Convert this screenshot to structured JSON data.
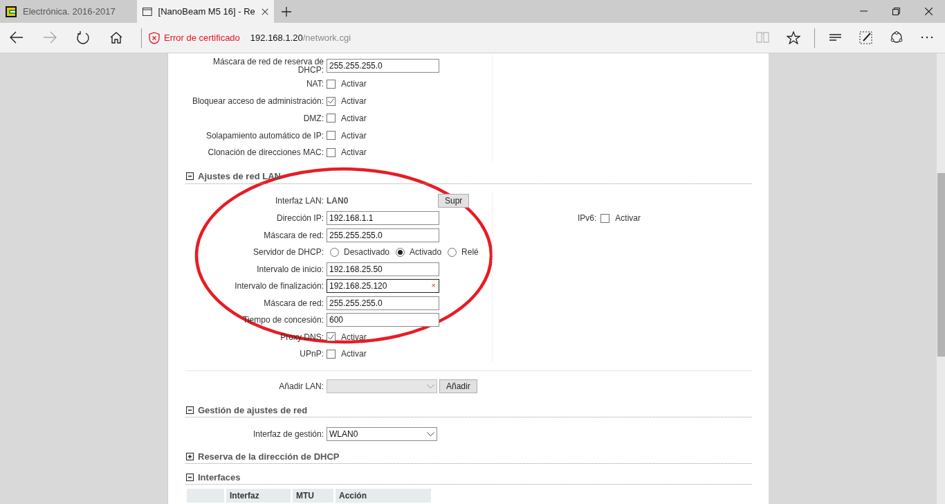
{
  "browser": {
    "tabs": [
      {
        "title": "Electrónica. 2016-2017",
        "selected": false
      },
      {
        "title": "[NanoBeam M5 16] - Re",
        "selected": true
      }
    ],
    "nav_buttons": [
      {
        "kind": "back",
        "disabled": false
      },
      {
        "kind": "forward",
        "disabled": true
      },
      {
        "kind": "refresh",
        "disabled": false
      },
      {
        "kind": "home",
        "disabled": false
      }
    ],
    "address": {
      "warning": "Error de certificado",
      "host": "192.168.1.20",
      "path": "/network.cgi"
    },
    "tools": [
      {
        "kind": "reading",
        "disabled": true
      },
      {
        "kind": "favorite",
        "disabled": false
      },
      {
        "kind": "hub",
        "disabled": false
      },
      {
        "kind": "note",
        "disabled": false
      },
      {
        "kind": "share",
        "disabled": false
      },
      {
        "kind": "more",
        "disabled": false
      }
    ]
  },
  "sections": [
    {
      "rows": [
        {
          "kind": "text",
          "label": "Máscara de red de reserva de DHCP:",
          "value": "255.255.255.0"
        },
        {
          "kind": "checkbox",
          "label": "NAT:",
          "option": "Activar",
          "checked": false
        },
        {
          "kind": "checkbox",
          "label": "Bloquear acceso de administración:",
          "option": "Activar",
          "checked": true
        },
        {
          "kind": "checkbox",
          "label": "DMZ:",
          "option": "Activar",
          "checked": false
        },
        {
          "kind": "checkbox",
          "label": "Solapamiento automático de IP:",
          "option": "Activar",
          "checked": false
        },
        {
          "kind": "checkbox",
          "label": "Clonación de direcciones MAC:",
          "option": "Activar",
          "checked": false
        }
      ]
    },
    {
      "title": "Ajustes de red LAN",
      "expanded": true,
      "rows": [
        {
          "kind": "static",
          "label": "Interfaz LAN:",
          "value": "LAN0",
          "button": "Supr"
        },
        {
          "kind": "text",
          "label": "Dirección IP:",
          "value": "192.168.1.1",
          "aside": {
            "label": "IPv6:",
            "option": "Activar",
            "checked": false
          }
        },
        {
          "kind": "text",
          "label": "Máscara de red:",
          "value": "255.255.255.0"
        },
        {
          "kind": "radio",
          "label": "Servidor de DHCP:",
          "options": [
            {
              "label": "Desactivado",
              "selected": false
            },
            {
              "label": "Activado",
              "selected": true
            },
            {
              "label": "Relé",
              "selected": false
            }
          ]
        },
        {
          "kind": "text",
          "label": "Intervalo de inicio:",
          "value": "192.168.25.50"
        },
        {
          "kind": "text",
          "label": "Intervalo de finalización:",
          "value": "192.168.25.120",
          "focused": true,
          "clear": "×"
        },
        {
          "kind": "text",
          "label": "Máscara de red:",
          "value": "255.255.255.0"
        },
        {
          "kind": "text",
          "label": "Tiempo de concesión:",
          "value": "600"
        },
        {
          "kind": "checkbox",
          "label": "Proxy DNS:",
          "option": "Activar",
          "checked": true
        },
        {
          "kind": "checkbox",
          "label": "UPnP:",
          "option": "Activar",
          "checked": false
        }
      ],
      "footer_row": {
        "kind": "select",
        "label": "Añadir LAN:",
        "disabled": true,
        "button": "Añadir"
      }
    },
    {
      "title": "Gestión de ajustes de red",
      "expanded": true,
      "rows": [
        {
          "kind": "select",
          "label": "Interfaz de gestión:",
          "value": "WLAN0",
          "disabled": false
        }
      ]
    },
    {
      "title": "Reserva de la dirección de DHCP",
      "expanded": false
    },
    {
      "title": "Interfaces",
      "expanded": true,
      "table": {
        "columns": [
          "Interfaz",
          "MTU",
          "Acción"
        ]
      }
    }
  ],
  "annotation": {
    "kind": "ellipse"
  }
}
